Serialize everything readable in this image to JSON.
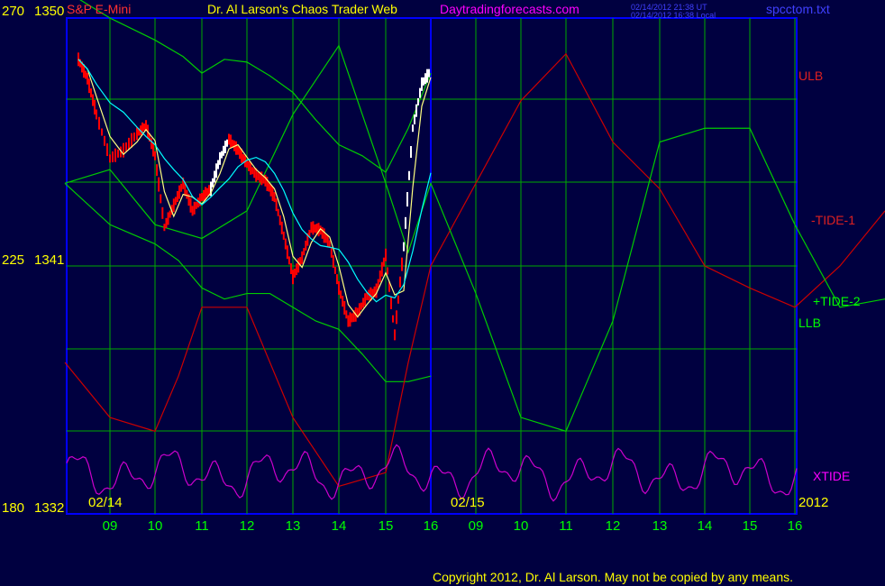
{
  "header": {
    "instrument": "S&P E-Mini",
    "title": "Dr. Al Larson's Chaos Trader Web",
    "site": "Daytradingforecasts.com",
    "timestamp_ut": "02/14/2012 21:38 UT",
    "timestamp_local": "02/14/2012 16:38 Local",
    "file": "spcctom.txt"
  },
  "labels": {
    "ulb": "ULB",
    "tide1": "-TIDE-1",
    "tide2": "+TIDE-2",
    "llb": "LLB",
    "xtide": "XTIDE",
    "date_left": "02/14",
    "date_mid": "02/15",
    "year": "2012",
    "copyright": "Copyright 2012, Dr. Al Larson. May not be copied by any means."
  },
  "y_axis": {
    "top": {
      "left": "270",
      "right": "1350"
    },
    "middle": {
      "left": "225",
      "right": "1341"
    },
    "bottom": {
      "left": "180",
      "right": "1332"
    }
  },
  "colors": {
    "background": "#000040",
    "grid": "#00aa00",
    "frame": "#0000ff",
    "price_down": "#ff0000",
    "price_up": "#ffffff",
    "ma_fast": "#ffff80",
    "ma_slow": "#00ffff",
    "ulb_llb": "#00cc00",
    "tide_red": "#cc0000",
    "tide_green": "#00cc00",
    "xtide": "#cc00cc",
    "date_green": "#00ff00",
    "axis_yellow": "#ffff00",
    "title_red": "#ff3030",
    "title_yellow": "#ffff00",
    "site_magenta": "#ff00ff",
    "timestamp_blue": "#4040ff"
  },
  "chart_data": {
    "type": "line",
    "title": "S&P E-Mini",
    "x_ticks_day1": [
      "09",
      "10",
      "11",
      "12",
      "13",
      "14",
      "15",
      "16"
    ],
    "x_ticks_day2": [
      "09",
      "10",
      "11",
      "12",
      "13",
      "14",
      "15",
      "16"
    ],
    "ylim": [
      1332,
      1350
    ],
    "series": [
      {
        "name": "price",
        "x": [
          8.3,
          8.5,
          8.7,
          9.0,
          9.3,
          9.6,
          9.8,
          10.0,
          10.2,
          10.4,
          10.6,
          10.8,
          11.0,
          11.2,
          11.4,
          11.6,
          11.8,
          12.0,
          12.2,
          12.4,
          12.6,
          12.8,
          13.0,
          13.2,
          13.4,
          13.6,
          13.8,
          14.0,
          14.2,
          14.4,
          14.6,
          14.8,
          15.0,
          15.2,
          15.4,
          15.6,
          15.8,
          16.0
        ],
        "y": [
          1348.5,
          1347.8,
          1346.5,
          1344.9,
          1345.2,
          1345.8,
          1346.1,
          1345.0,
          1342.4,
          1343.2,
          1344.0,
          1343.0,
          1343.5,
          1343.8,
          1344.9,
          1345.6,
          1345.2,
          1344.7,
          1344.3,
          1344.1,
          1343.5,
          1342.1,
          1340.6,
          1341.3,
          1342.4,
          1342.3,
          1341.8,
          1340.2,
          1339.0,
          1339.3,
          1339.9,
          1340.1,
          1341.4,
          1338.5,
          1341.7,
          1346.0,
          1347.6,
          1348.1
        ]
      },
      {
        "name": "ULB",
        "x": [
          8.0,
          9.0,
          10.0,
          10.6,
          11.0,
          11.5,
          12.0,
          12.5,
          13.0,
          13.5,
          14.0,
          14.5,
          15.0,
          15.5,
          16.0
        ],
        "y": [
          1351.0,
          1350.0,
          1349.2,
          1348.6,
          1348.0,
          1348.5,
          1348.4,
          1347.9,
          1347.3,
          1346.3,
          1345.4,
          1345.0,
          1344.4,
          1346.0,
          1348.0
        ]
      },
      {
        "name": "LLB",
        "x": [
          8.0,
          9.0,
          10.0,
          10.5,
          11.0,
          11.5,
          12.0,
          12.5,
          13.0,
          13.5,
          14.0,
          14.5,
          15.0,
          15.5,
          16.0
        ],
        "y": [
          1344.0,
          1342.5,
          1341.8,
          1341.2,
          1340.2,
          1339.8,
          1340.0,
          1340.0,
          1339.5,
          1339.0,
          1338.7,
          1337.8,
          1336.8,
          1336.8,
          1337.0
        ]
      },
      {
        "name": "-TIDE-1",
        "x": [
          8.0,
          9.0,
          10.0,
          10.5,
          11.0,
          12.0,
          13.0,
          14.0,
          15.0,
          15.5,
          16.0,
          17.0,
          18.0,
          19.0,
          20.0,
          21.0,
          22.0,
          23.0,
          24.0,
          25.0,
          26.0
        ],
        "y": [
          1337.5,
          1335.5,
          1335.0,
          1337.0,
          1339.5,
          1339.5,
          1335.5,
          1333.0,
          1333.5,
          1337.5,
          1341.0,
          1344.0,
          1347.0,
          1348.7,
          1345.5,
          1343.8,
          1341.0,
          1340.2,
          1339.5,
          1341.0,
          1343.0
        ]
      },
      {
        "name": "+TIDE-2",
        "x": [
          8.0,
          9.0,
          10.0,
          11.0,
          12.0,
          13.0,
          14.0,
          15.0,
          15.5,
          16.0,
          17.0,
          18.0,
          19.0,
          20.0,
          21.0,
          22.0,
          23.0,
          24.0,
          25.0,
          26.0
        ],
        "y": [
          1344.0,
          1344.5,
          1342.5,
          1342.0,
          1343.0,
          1346.5,
          1349.0,
          1344.0,
          1341.5,
          1344.0,
          1340.0,
          1335.5,
          1335.0,
          1339.0,
          1345.5,
          1346.0,
          1346.0,
          1342.5,
          1339.5,
          1339.8
        ]
      },
      {
        "name": "XTIDE"
      }
    ]
  }
}
